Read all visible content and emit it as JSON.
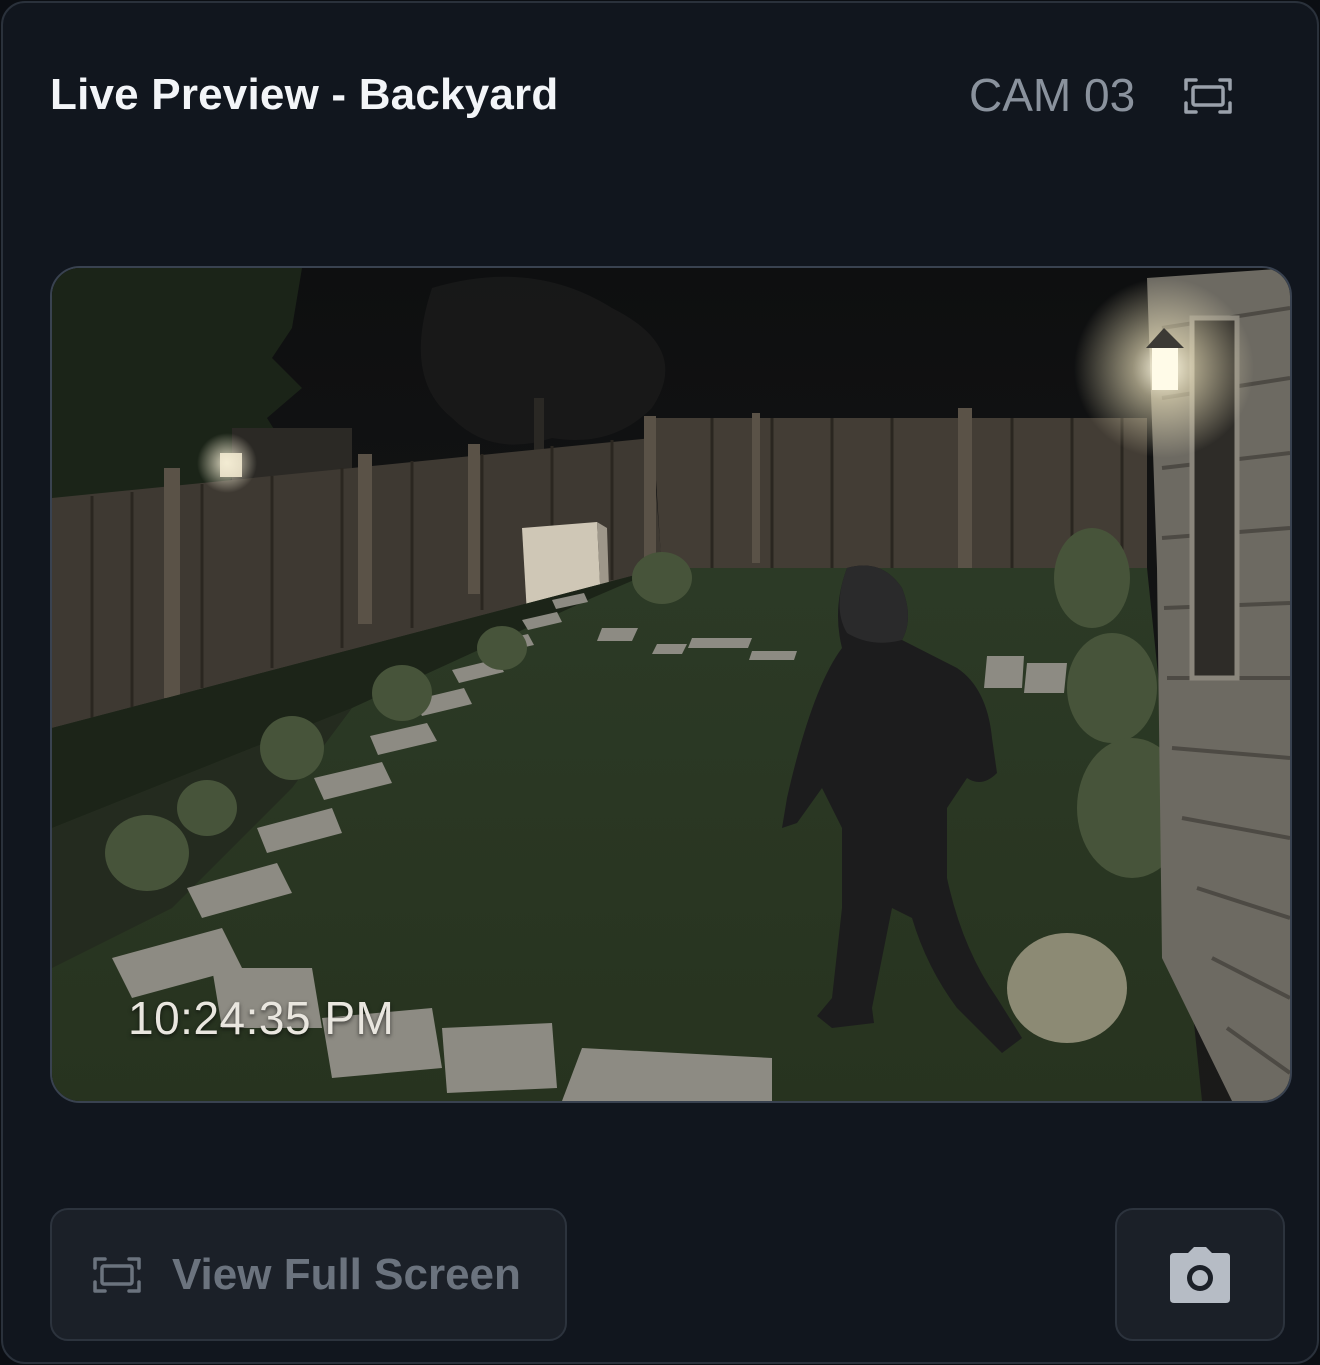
{
  "header": {
    "title": "Live Preview - Backyard",
    "camera_id": "CAM 03",
    "fullscreen_icon": "fullscreen-icon"
  },
  "video": {
    "timestamp": "10:24:35 PM",
    "scene": "Night backyard security feed with hooded person walking across lawn"
  },
  "actions": {
    "fullscreen_label": "View Full Screen",
    "fullscreen_icon": "fullscreen-icon",
    "snapshot_icon": "camera-icon"
  },
  "colors": {
    "background": "#11161e",
    "border": "#2a313b",
    "title": "#f3f5f8",
    "muted": "#8a929d",
    "button_bg": "#1b2028",
    "button_text": "#6b737e"
  }
}
